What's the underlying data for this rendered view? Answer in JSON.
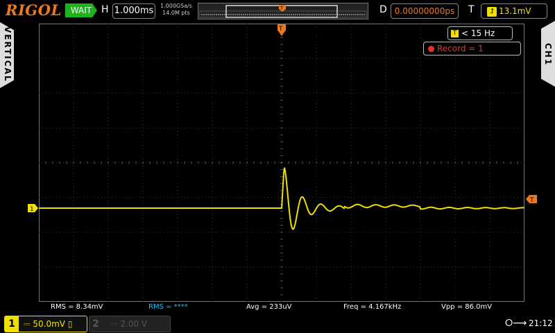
{
  "header": {
    "logo": "RIGOL",
    "status": "WAIT",
    "h_label": "H",
    "timebase": "1.000ms",
    "sample_rate": "1.000GSa/s",
    "mem_depth": "14.0M pts",
    "d_label": "D",
    "delay": "0.00000000ps",
    "t_label": "T",
    "trigger_level": "13.1mV",
    "trigger_icon": "rising-edge-icon"
  },
  "side": {
    "left_tab": "VERTICAL",
    "right_tab": "CH1"
  },
  "overlay": {
    "freq_counter": "< 15 Hz",
    "record": "Record = 1"
  },
  "markers": {
    "trigger_pos": "T",
    "ch1_ground": "1",
    "trigger_level": "T"
  },
  "measurements": [
    {
      "label": "RMS = 8.34mV",
      "color": "#ffffff"
    },
    {
      "label": "RMS = ****",
      "color": "#20c0f0"
    },
    {
      "label": "Avg = 233uV",
      "color": "#ffffff"
    },
    {
      "label": "Freq = 4.167kHz",
      "color": "#ffffff"
    },
    {
      "label": "Vpp = 86.0mV",
      "color": "#ffffff"
    }
  ],
  "channels": [
    {
      "num": "1",
      "coupling": "DC",
      "scale": "50.0mV",
      "active": true
    },
    {
      "num": "2",
      "coupling": "DC",
      "scale": "2.00 V",
      "active": false
    }
  ],
  "clock": "21:12",
  "colors": {
    "ch1": "#f0e000",
    "accent": "#f07818",
    "wait": "#1db31d",
    "record": "#e83030"
  }
}
